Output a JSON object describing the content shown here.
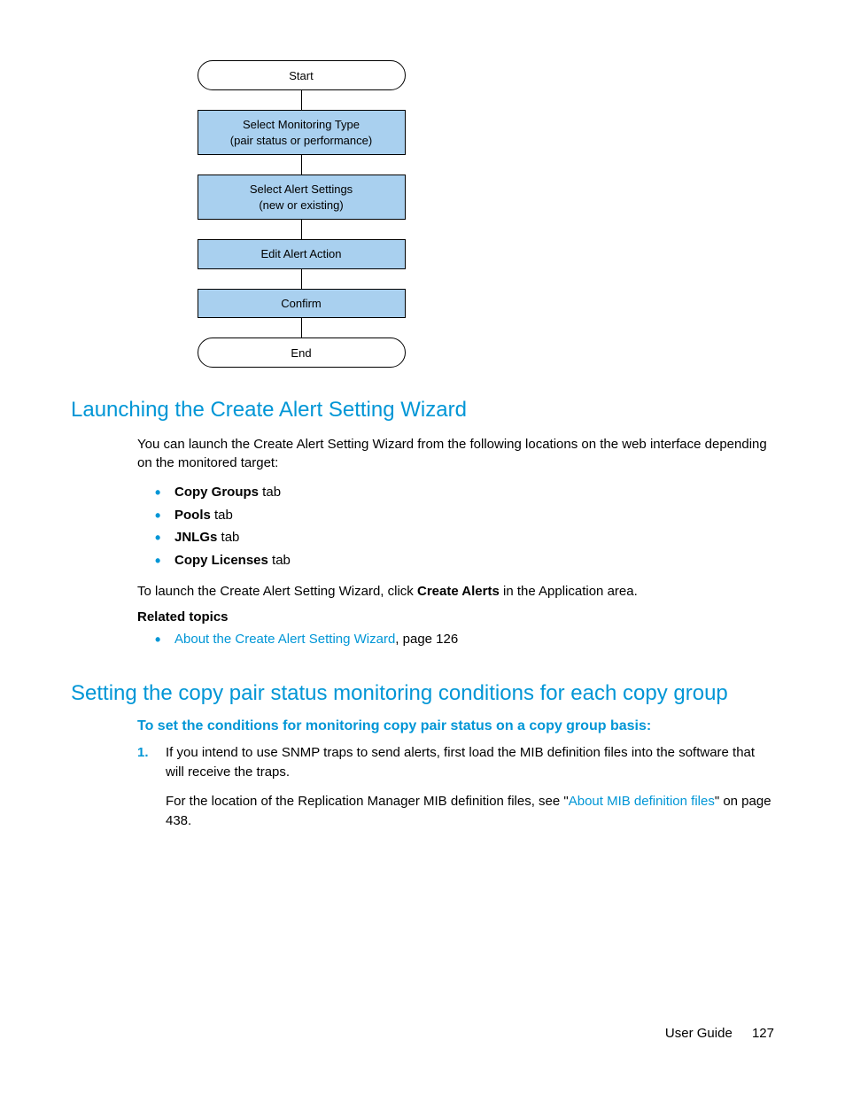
{
  "flowchart": {
    "start": "Start",
    "step1a": "Select Monitoring Type",
    "step1b": "(pair status or performance)",
    "step2a": "Select Alert Settings",
    "step2b": "(new or existing)",
    "step3": "Edit Alert Action",
    "step4": "Confirm",
    "end": "End"
  },
  "section1": {
    "heading": "Launching the Create Alert Setting Wizard",
    "intro": "You can launch the Create Alert Setting Wizard from the following locations on the web interface depending on the monitored target:",
    "bullets": [
      {
        "bold": "Copy Groups",
        "rest": " tab"
      },
      {
        "bold": "Pools",
        "rest": " tab"
      },
      {
        "bold": "JNLGs",
        "rest": " tab"
      },
      {
        "bold": "Copy Licenses",
        "rest": " tab"
      }
    ],
    "launch_pre": "To launch the Create Alert Setting Wizard, click ",
    "launch_bold": "Create Alerts",
    "launch_post": " in the Application area.",
    "related_heading": "Related topics",
    "related_link": "About the Create Alert Setting Wizard",
    "related_page": ", page 126"
  },
  "section2": {
    "heading": "Setting the copy pair status monitoring conditions for each copy group",
    "subhead": "To set the conditions for monitoring copy pair status on a copy group basis:",
    "step_num": "1.",
    "step1_p1": "If you intend to use SNMP traps to send alerts, first load the MIB definition files into the software that will receive the traps.",
    "step1_p2_pre": "For the location of the Replication Manager MIB definition files, see \"",
    "step1_p2_link": "About MIB definition files",
    "step1_p2_post": "\" on page 438."
  },
  "footer": {
    "label": "User Guide",
    "page": "127"
  }
}
